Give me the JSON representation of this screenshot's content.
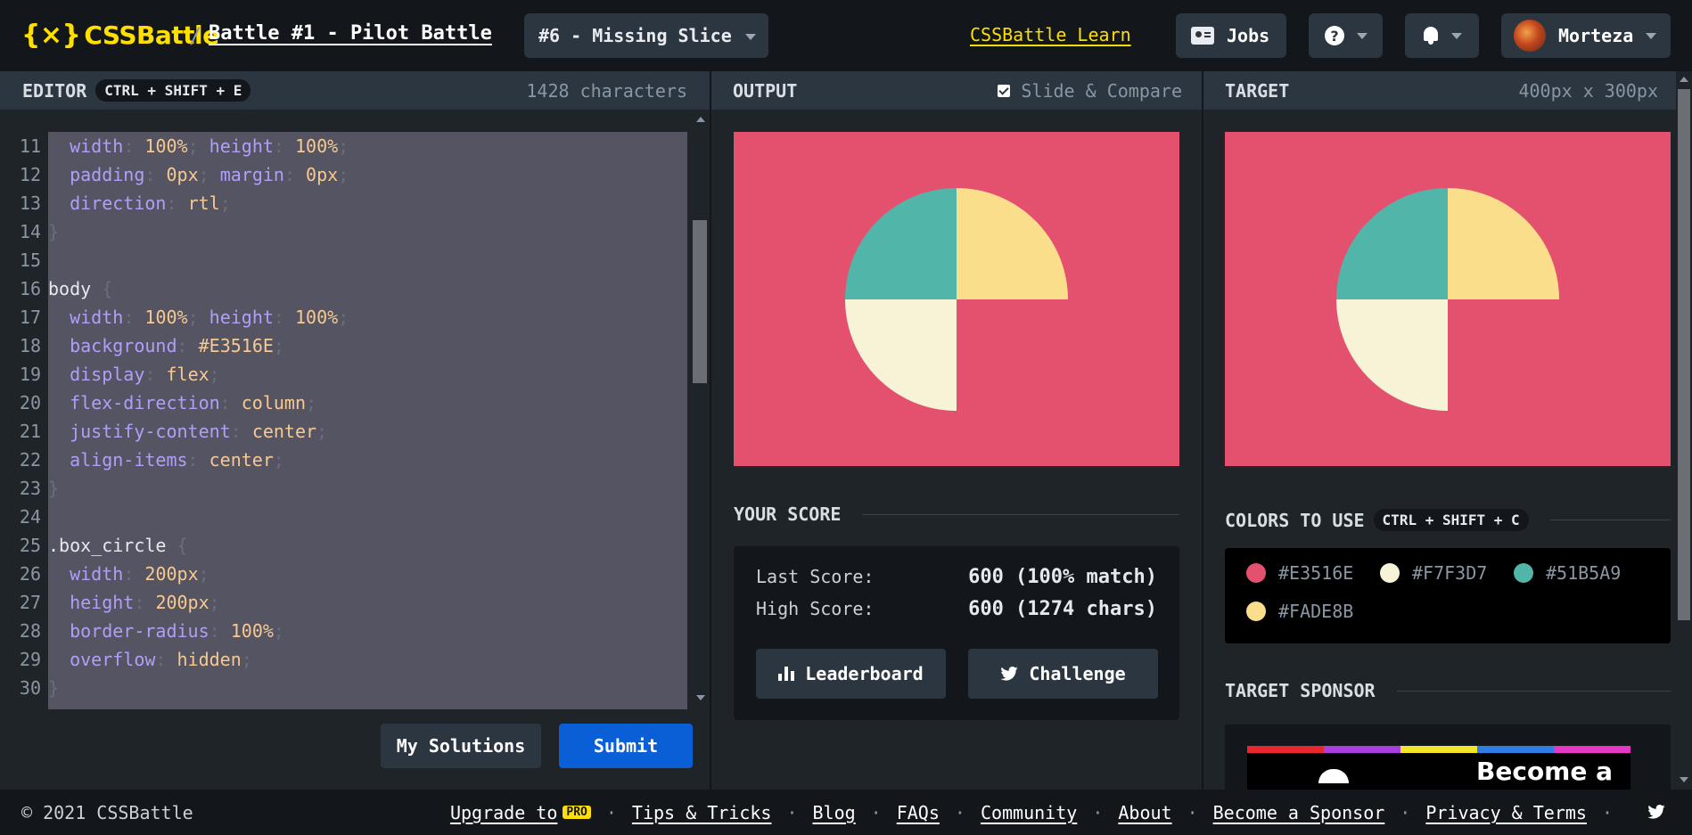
{
  "header": {
    "logo_text": "CSSBattle",
    "logo_brace": "{×}",
    "breadcrumb_sep": "/",
    "battle_title": "Battle #1 - Pilot Battle",
    "target_select": "#6 - Missing Slice",
    "learn_link": "CSSBattle Learn",
    "jobs_label": "Jobs",
    "help_glyph": "?",
    "user_name": "Morteza"
  },
  "editor": {
    "label": "EDITOR",
    "shortcut": "CTRL + SHIFT + E",
    "char_count": "1428 characters",
    "line_numbers": [
      "11",
      "12",
      "13",
      "14",
      "15",
      "16",
      "17",
      "18",
      "19",
      "20",
      "21",
      "22",
      "23",
      "24",
      "25",
      "26",
      "27",
      "28",
      "29",
      "30"
    ],
    "lines": [
      {
        "ind": "  ",
        "p1": "width",
        "v1": "100%",
        "p2": "height",
        "v2": "100%"
      },
      {
        "ind": "  ",
        "p1": "padding",
        "v1": "0px",
        "p2": "margin",
        "v2": "0px"
      },
      {
        "ind": "  ",
        "p1": "direction",
        "v1": "rtl"
      },
      {
        "ind": "",
        "brace": "}"
      },
      {
        "ind": ""
      },
      {
        "ind": "",
        "sel": "body",
        "brace": "{"
      },
      {
        "ind": "  ",
        "p1": "width",
        "v1": "100%",
        "p2": "height",
        "v2": "100%"
      },
      {
        "ind": "  ",
        "p1": "background",
        "v1": "#E3516E"
      },
      {
        "ind": "  ",
        "p1": "display",
        "v1": "flex"
      },
      {
        "ind": "  ",
        "p1": "flex-direction",
        "v1": "column"
      },
      {
        "ind": "  ",
        "p1": "justify-content",
        "v1": "center"
      },
      {
        "ind": "  ",
        "p1": "align-items",
        "v1": "center"
      },
      {
        "ind": "",
        "brace": "}"
      },
      {
        "ind": ""
      },
      {
        "ind": "",
        "sel": ".box_circle",
        "brace": "{"
      },
      {
        "ind": "  ",
        "p1": "width",
        "v1": "200px"
      },
      {
        "ind": "  ",
        "p1": "height",
        "v1": "200px"
      },
      {
        "ind": "  ",
        "p1": "border-radius",
        "v1": "100%"
      },
      {
        "ind": "  ",
        "p1": "overflow",
        "v1": "hidden"
      },
      {
        "ind": "",
        "brace": "}"
      }
    ],
    "my_solutions_label": "My Solutions",
    "submit_label": "Submit"
  },
  "output": {
    "label": "OUTPUT",
    "slide_compare_label": "Slide & Compare",
    "slide_compare_checked": true,
    "score_heading": "YOUR SCORE",
    "last_score_label": "Last Score:",
    "last_score_value": "600 (100% match)",
    "high_score_label": "High Score:",
    "high_score_value": "600 (1274 chars)",
    "leaderboard_label": "Leaderboard",
    "challenge_label": "Challenge"
  },
  "target": {
    "label": "TARGET",
    "dimensions": "400px x 300px",
    "colors_heading": "COLORS TO USE",
    "colors_shortcut": "CTRL + SHIFT + C",
    "colors": [
      {
        "hex": "#E3516E",
        "label": "#E3516E"
      },
      {
        "hex": "#F7F3D7",
        "label": "#F7F3D7"
      },
      {
        "hex": "#51B5A9",
        "label": "#51B5A9"
      },
      {
        "hex": "#FADE8B",
        "label": "#FADE8B"
      }
    ],
    "sponsor_heading": "TARGET SPONSOR",
    "sponsor_text": "Become a",
    "sponsor_stripe_colors": [
      "#e8262b",
      "#a93ee0",
      "#f2e426",
      "#2f7de6",
      "#e637c4"
    ]
  },
  "footer": {
    "copyright": "© 2021 CSSBattle",
    "links": [
      "Upgrade to",
      "Tips & Tricks",
      "Blog",
      "FAQs",
      "Community",
      "About",
      "Become a Sponsor",
      "Privacy & Terms"
    ],
    "pro_badge": "PRO",
    "separator": "·"
  },
  "theme": {
    "accent": "#FFDF00",
    "submit_blue": "#0A5FD6",
    "bg_dark": "#13171B",
    "bg_panel": "#1F2429",
    "bar_bg": "#2C3640"
  }
}
